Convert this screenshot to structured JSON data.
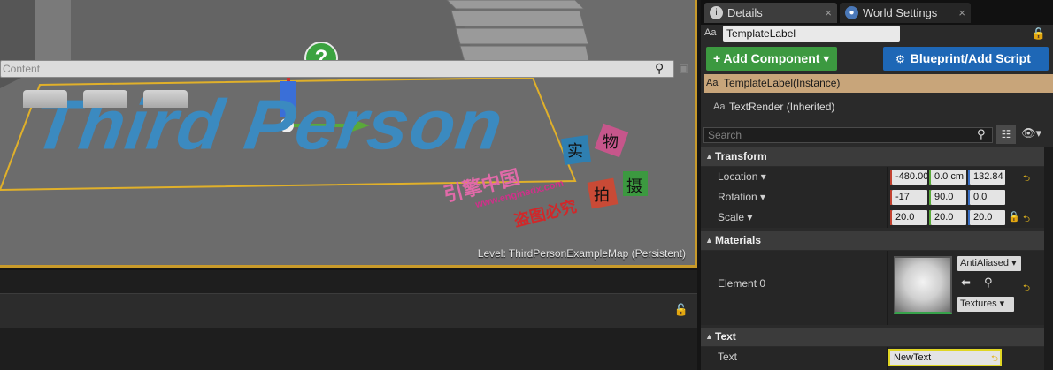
{
  "viewport": {
    "scene_text": "Third Person",
    "help_icon": "?",
    "level_label": "Level:  ThirdPersonExampleMap (Persistent)",
    "watermark": {
      "cn_site": "引擎中国",
      "url": "www.enginedx.com",
      "notice": "盗图必究",
      "tiles": [
        "实",
        "物",
        "拍",
        "摄"
      ]
    }
  },
  "content_browser": {
    "search_placeholder": "Content"
  },
  "details": {
    "tabs": [
      {
        "label": "Details",
        "icon": "info-icon"
      },
      {
        "label": "World Settings",
        "icon": "globe-icon"
      }
    ],
    "tab_close": "×",
    "name_prefix": "Aa",
    "name_value": "TemplateLabel",
    "add_component_label": "+ Add Component ▾",
    "blueprint_label": "Blueprint/Add Script",
    "instance_label": "TemplateLabel(Instance)",
    "inherited_label": "TextRender (Inherited)",
    "search_placeholder": "Search",
    "sections": {
      "transform": "Transform",
      "materials": "Materials",
      "text": "Text"
    },
    "transform": {
      "location": {
        "label": "Location ▾",
        "x": "-480.00",
        "y": "0.0 cm",
        "z": "132.84"
      },
      "rotation": {
        "label": "Rotation ▾",
        "x": "-17",
        "y": "90.0",
        "z": "0.0"
      },
      "scale": {
        "label": "Scale ▾",
        "x": "20.0",
        "y": "20.0",
        "z": "20.0"
      }
    },
    "materials": {
      "element_label": "Element 0",
      "material_combo": "AntiAliased ▾",
      "textures_combo": "Textures ▾"
    },
    "text": {
      "label": "Text",
      "value": "NewText"
    },
    "colors": {
      "add_component": "#3c9940",
      "blueprint": "#1e67b6",
      "selected_row": "#c8a57a",
      "axis_x": "#c2412f",
      "axis_y": "#5aa93a",
      "axis_z": "#3a6fc4"
    }
  }
}
